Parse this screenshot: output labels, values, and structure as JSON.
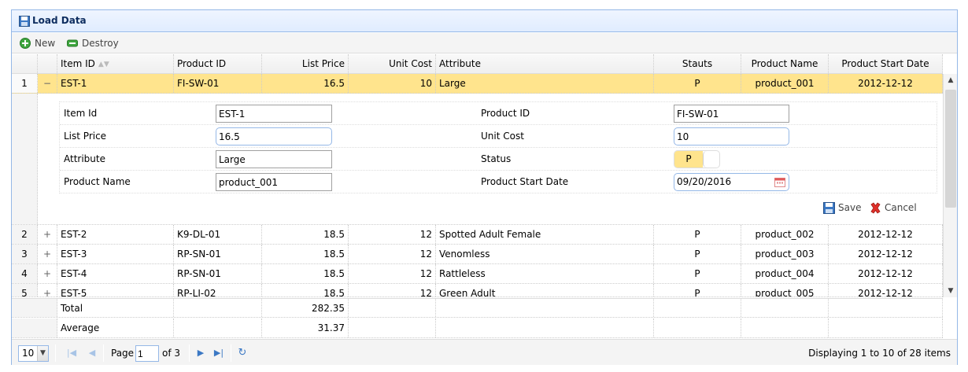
{
  "panel": {
    "title": "Load Data"
  },
  "toolbar": {
    "new_label": "New",
    "destroy_label": "Destroy"
  },
  "columns": {
    "item_id": "Item ID",
    "product_id": "Product ID",
    "list_price": "List Price",
    "unit_cost": "Unit Cost",
    "attribute": "Attribute",
    "status": "Stauts",
    "product_name": "Product Name",
    "product_start_date": "Product Start Date"
  },
  "rows": [
    {
      "num": "1",
      "expander": "−",
      "item_id": "EST-1",
      "product_id": "FI-SW-01",
      "list_price": "16.5",
      "unit_cost": "10",
      "attribute": "Large",
      "status": "P",
      "product_name": "product_001",
      "start_date": "2012-12-12"
    },
    {
      "num": "2",
      "expander": "+",
      "item_id": "EST-2",
      "product_id": "K9-DL-01",
      "list_price": "18.5",
      "unit_cost": "12",
      "attribute": "Spotted Adult Female",
      "status": "P",
      "product_name": "product_002",
      "start_date": "2012-12-12"
    },
    {
      "num": "3",
      "expander": "+",
      "item_id": "EST-3",
      "product_id": "RP-SN-01",
      "list_price": "18.5",
      "unit_cost": "12",
      "attribute": "Venomless",
      "status": "P",
      "product_name": "product_003",
      "start_date": "2012-12-12"
    },
    {
      "num": "4",
      "expander": "+",
      "item_id": "EST-4",
      "product_id": "RP-SN-01",
      "list_price": "18.5",
      "unit_cost": "12",
      "attribute": "Rattleless",
      "status": "P",
      "product_name": "product_004",
      "start_date": "2012-12-12"
    },
    {
      "num": "5",
      "expander": "+",
      "item_id": "EST-5",
      "product_id": "RP-LI-02",
      "list_price": "18.5",
      "unit_cost": "12",
      "attribute": "Green Adult",
      "status": "P",
      "product_name": "product_005",
      "start_date": "2012-12-12"
    }
  ],
  "detail_form": {
    "item_id_label": "Item Id",
    "item_id_value": "EST-1",
    "product_id_label": "Product ID",
    "product_id_value": "FI-SW-01",
    "list_price_label": "List Price",
    "list_price_value": "16.5",
    "unit_cost_label": "Unit Cost",
    "unit_cost_value": "10",
    "attribute_label": "Attribute",
    "attribute_value": "Large",
    "status_label": "Status",
    "status_value": "P",
    "product_name_label": "Product Name",
    "product_name_value": "product_001",
    "start_date_label": "Product Start Date",
    "start_date_value": "09/20/2016",
    "save_label": "Save",
    "cancel_label": "Cancel"
  },
  "footer": {
    "total_label": "Total",
    "total_value": "282.35",
    "average_label": "Average",
    "average_value": "31.37"
  },
  "pager": {
    "page_size": "10",
    "page_label": "Page",
    "page_value": "1",
    "of_label": "of 3",
    "info": "Displaying 1 to 10 of 28 items"
  },
  "colors": {
    "selected_row": "#ffe48d",
    "panel_border": "#95b8e7",
    "header_text": "#0e2d5f"
  },
  "icons": [
    "save-disk-icon",
    "add-icon",
    "remove-icon",
    "sort-icon",
    "expand-icon",
    "collapse-icon",
    "calendar-icon",
    "cancel-x-icon",
    "first-page-icon",
    "prev-page-icon",
    "next-page-icon",
    "last-page-icon",
    "refresh-icon",
    "scroll-up-icon",
    "scroll-down-icon"
  ]
}
